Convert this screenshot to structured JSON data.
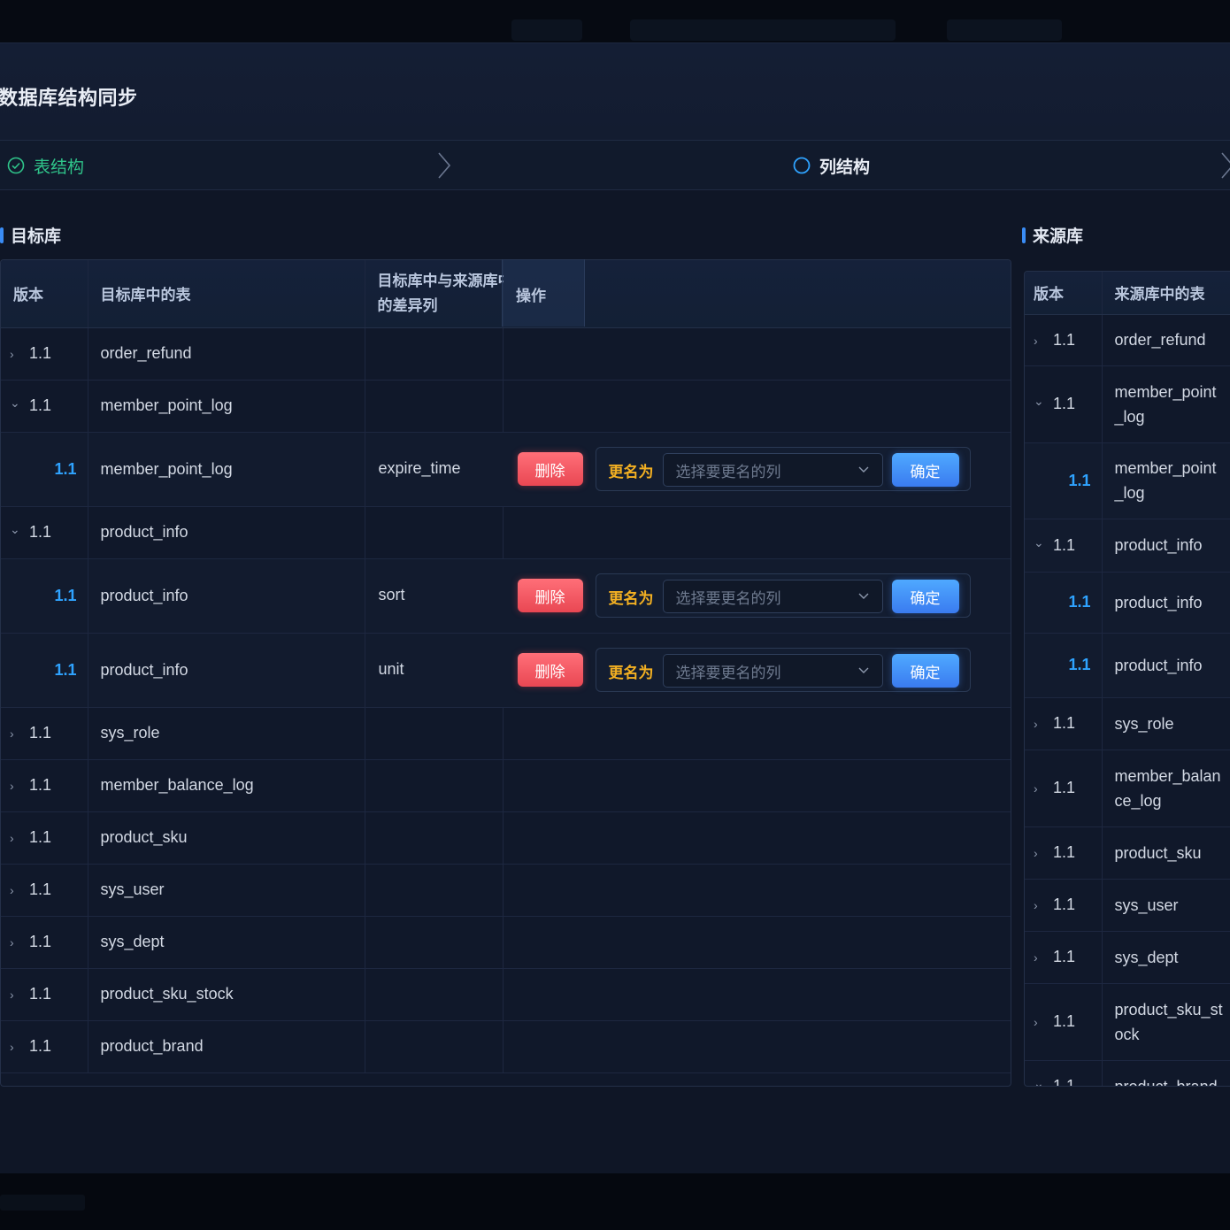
{
  "dialog": {
    "title": "数据库结构同步"
  },
  "steps": [
    {
      "label": "表结构",
      "state": "done",
      "color": "#2fc48a"
    },
    {
      "label": "列结构",
      "state": "active",
      "color": "#2fa3ff"
    }
  ],
  "target": {
    "title": "目标库",
    "headers": {
      "version": "版本",
      "table": "目标库中的表",
      "diff_col": "目标库中与来源库中同名表的差异列",
      "operation": "操作"
    },
    "rows": [
      {
        "type": "parent",
        "expand": "collapsed",
        "version": "1.1",
        "table": "order_refund"
      },
      {
        "type": "parent",
        "expand": "expanded",
        "version": "1.1",
        "table": "member_point_log"
      },
      {
        "type": "child",
        "version": "1.1",
        "table": "member_point_log",
        "diff_col": "expire_time"
      },
      {
        "type": "parent",
        "expand": "expanded",
        "version": "1.1",
        "table": "product_info"
      },
      {
        "type": "child",
        "version": "1.1",
        "table": "product_info",
        "diff_col": "sort"
      },
      {
        "type": "child",
        "version": "1.1",
        "table": "product_info",
        "diff_col": "unit"
      },
      {
        "type": "parent",
        "expand": "collapsed",
        "version": "1.1",
        "table": "sys_role"
      },
      {
        "type": "parent",
        "expand": "collapsed",
        "version": "1.1",
        "table": "member_balance_log"
      },
      {
        "type": "parent",
        "expand": "collapsed",
        "version": "1.1",
        "table": "product_sku"
      },
      {
        "type": "parent",
        "expand": "collapsed",
        "version": "1.1",
        "table": "sys_user"
      },
      {
        "type": "parent",
        "expand": "collapsed",
        "version": "1.1",
        "table": "sys_dept"
      },
      {
        "type": "parent",
        "expand": "collapsed",
        "version": "1.1",
        "table": "product_sku_stock"
      },
      {
        "type": "parent",
        "expand": "collapsed",
        "version": "1.1",
        "table": "product_brand"
      }
    ],
    "actions": {
      "delete_label": "删除",
      "rename_label": "更名为",
      "select_placeholder": "选择要更名的列",
      "confirm_label": "确定"
    }
  },
  "source": {
    "title": "来源库",
    "headers": {
      "version": "版本",
      "table": "来源库中的表"
    },
    "rows": [
      {
        "type": "parent",
        "expand": "collapsed",
        "version": "1.1",
        "table": [
          "order_refund"
        ]
      },
      {
        "type": "parent",
        "expand": "expanded",
        "version": "1.1",
        "table": [
          "member_point",
          "_log"
        ]
      },
      {
        "type": "child",
        "version": "1.1",
        "table": [
          "member_point",
          "_log"
        ]
      },
      {
        "type": "parent",
        "expand": "expanded",
        "version": "1.1",
        "table": [
          "product_info"
        ]
      },
      {
        "type": "child",
        "version": "1.1",
        "table": [
          "product_info"
        ]
      },
      {
        "type": "child",
        "version": "1.1",
        "table": [
          "product_info"
        ]
      },
      {
        "type": "parent",
        "expand": "collapsed",
        "version": "1.1",
        "table": [
          "sys_role"
        ]
      },
      {
        "type": "parent",
        "expand": "collapsed",
        "version": "1.1",
        "table": [
          "member_balan",
          "ce_log"
        ]
      },
      {
        "type": "parent",
        "expand": "collapsed",
        "version": "1.1",
        "table": [
          "product_sku"
        ]
      },
      {
        "type": "parent",
        "expand": "collapsed",
        "version": "1.1",
        "table": [
          "sys_user"
        ]
      },
      {
        "type": "parent",
        "expand": "collapsed",
        "version": "1.1",
        "table": [
          "sys_dept"
        ]
      },
      {
        "type": "parent",
        "expand": "collapsed",
        "version": "1.1",
        "table": [
          "product_sku_st",
          "ock"
        ]
      },
      {
        "type": "parent",
        "expand": "expanded",
        "version": "1.1",
        "table": [
          "product_brand"
        ]
      }
    ]
  },
  "icons": {
    "step_done": "check-circle-icon",
    "step_active": "circle-icon",
    "step_arrow": "chevron-right-icon",
    "expand": "chevron-down-icon",
    "collapse": "chevron-right-icon",
    "select": "chevron-down-icon"
  },
  "colors": {
    "accent": "#2fa3ff",
    "success": "#2fc48a",
    "danger": "#e94753",
    "warning": "#f3b022"
  }
}
